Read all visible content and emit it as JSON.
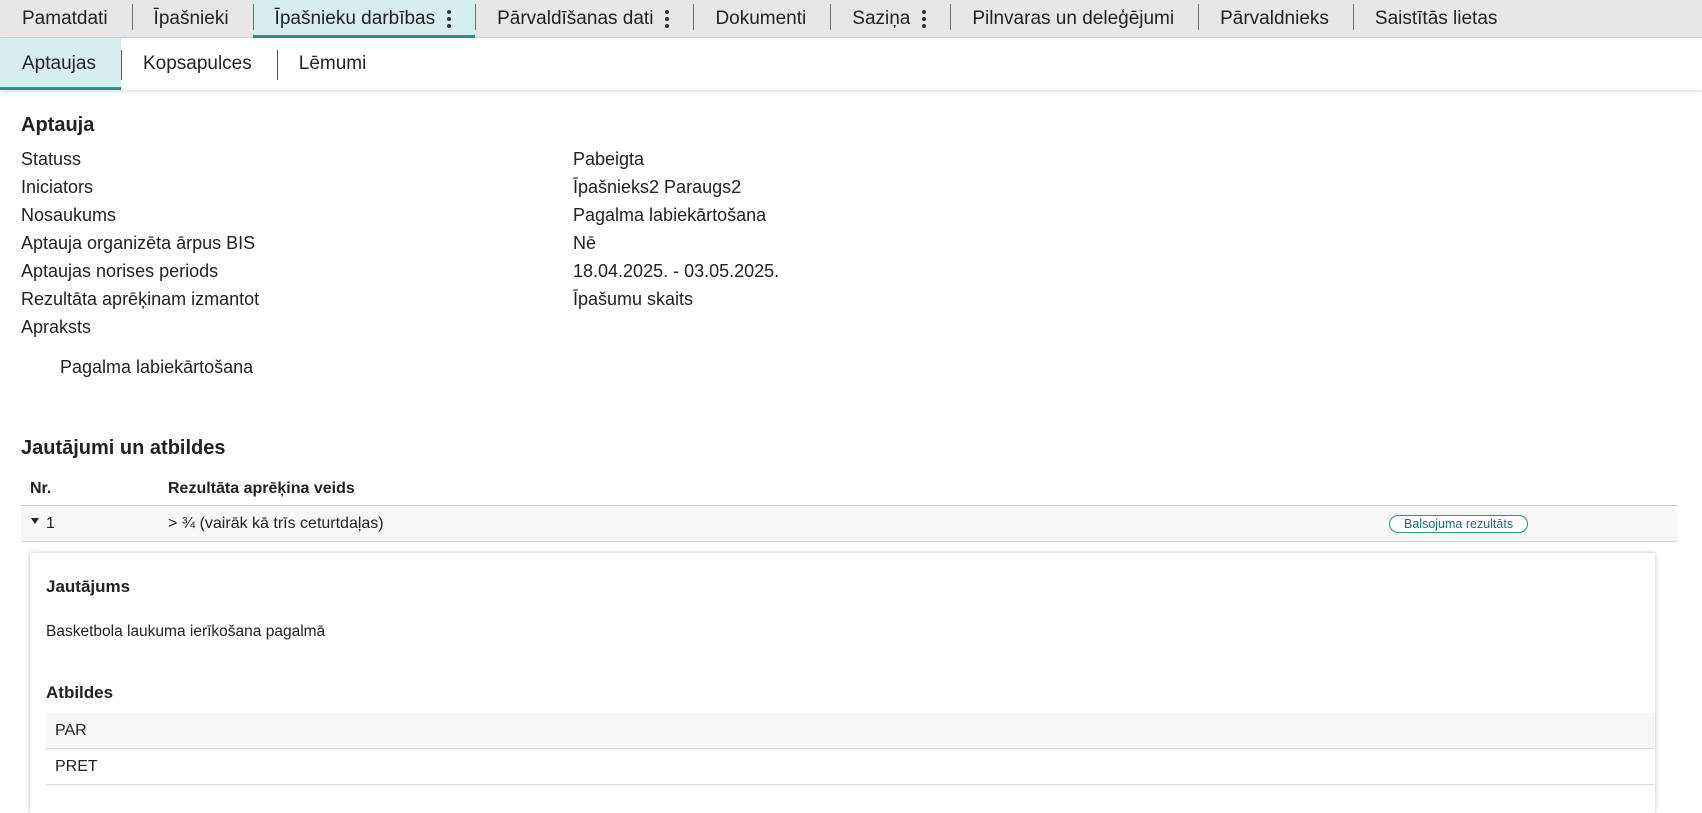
{
  "top_tabs": [
    {
      "label": "Pamatdati"
    },
    {
      "label": "Īpašnieki"
    },
    {
      "label": "Īpašnieku darbības"
    },
    {
      "label": "Pārvaldīšanas dati"
    },
    {
      "label": "Dokumenti"
    },
    {
      "label": "Saziņa"
    },
    {
      "label": "Pilnvaras un deleģējumi"
    },
    {
      "label": "Pārvaldnieks"
    },
    {
      "label": "Saistītās lietas"
    }
  ],
  "sub_tabs": [
    {
      "label": "Aptaujas"
    },
    {
      "label": "Kopsapulces"
    },
    {
      "label": "Lēmumi"
    }
  ],
  "survey": {
    "title": "Aptauja",
    "fields": [
      {
        "label": "Statuss",
        "value": "Pabeigta"
      },
      {
        "label": "Iniciators",
        "value": "Īpašnieks2 Paraugs2"
      },
      {
        "label": "Nosaukums",
        "value": "Pagalma labiekārtošana"
      },
      {
        "label": "Aptauja organizēta ārpus BIS",
        "value": "Nē"
      },
      {
        "label": "Aptaujas norises periods",
        "value": "18.04.2025. - 03.05.2025."
      },
      {
        "label": "Rezultāta aprēķinam izmantot",
        "value": "Īpašumu skaits"
      },
      {
        "label": "Apraksts",
        "value": ""
      }
    ],
    "description": "Pagalma labiekārtošana"
  },
  "qa": {
    "title": "Jautājumi un atbildes",
    "columns": {
      "nr": "Nr.",
      "calc_type": "Rezultāta aprēķina veids"
    },
    "row": {
      "nr": "1",
      "calc_type": "> ¾ (vairāk kā trīs ceturtdaļas)",
      "badge": "Balsojuma rezultāts"
    },
    "detail": {
      "question_title": "Jautājums",
      "question_text": "Basketbola laukuma ierīkošana pagalmā",
      "answers_title": "Atbildes",
      "answers": [
        "PAR",
        "PRET"
      ]
    }
  },
  "colors": {
    "accent": "#2f8d8d",
    "active_tab_bg": "#d7eeee",
    "tabbar_bg": "#e7e7e7"
  }
}
